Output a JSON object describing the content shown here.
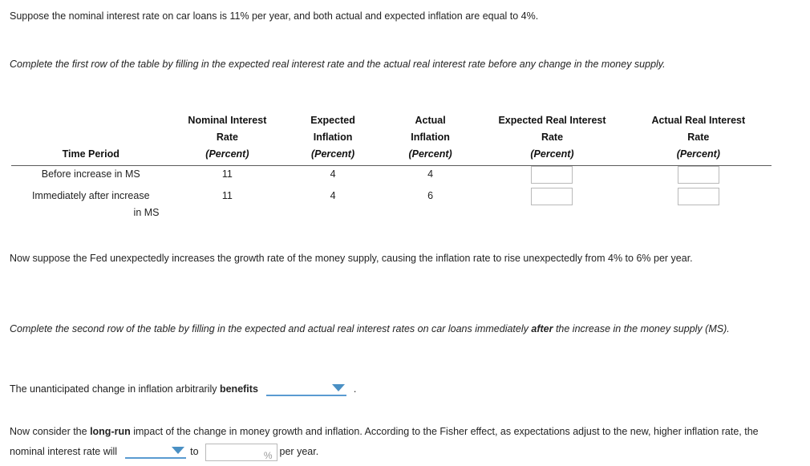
{
  "intro": {
    "line": "Suppose the nominal interest rate on car loans is 11% per year, and both actual and expected inflation are equal to 4%."
  },
  "instructions": {
    "first_row": "Complete the first row of the table by filling in the expected real interest rate and the actual real interest rate before any change in the money supply.",
    "second_row_pre": "Complete the second row of the table by filling in the expected and actual real interest rates on car loans immediately ",
    "second_row_bold": "after",
    "second_row_post": " the increase in the money supply (MS)."
  },
  "table": {
    "headers": {
      "time_period": "Time Period",
      "nominal": {
        "line1": "Nominal Interest",
        "line2": "Rate",
        "unit": "(Percent)"
      },
      "expected_inflation": {
        "line1": "Expected",
        "line2": "Inflation",
        "unit": "(Percent)"
      },
      "actual_inflation": {
        "line1": "Actual",
        "line2": "Inflation",
        "unit": "(Percent)"
      },
      "expected_real": {
        "line1": "Expected Real Interest",
        "line2": "Rate",
        "unit": "(Percent)"
      },
      "actual_real": {
        "line1": "Actual Real Interest",
        "line2": "Rate",
        "unit": "(Percent)"
      }
    },
    "rows": [
      {
        "period_line1": "Before increase in MS",
        "period_line2": "",
        "nominal": "11",
        "expected_inflation": "4",
        "actual_inflation": "4",
        "expected_real": "",
        "actual_real": ""
      },
      {
        "period_line1": "Immediately after increase",
        "period_line2": "in MS",
        "nominal": "11",
        "expected_inflation": "4",
        "actual_inflation": "6",
        "expected_real": "",
        "actual_real": ""
      }
    ]
  },
  "fed_paragraph": "Now suppose the Fed unexpectedly increases the growth rate of the money supply, causing the inflation rate to rise unexpectedly from 4% to 6% per year.",
  "benefits_sentence": {
    "pre": "The unanticipated change in inflation arbitrarily ",
    "bold": "benefits",
    "dropdown_value": "",
    "period": "."
  },
  "longrun_sentence": {
    "pre": "Now consider the ",
    "bold": "long-run",
    "mid": " impact of the change in money growth and inflation. According to the Fisher effect, as expectations adjust to the new, higher inflation rate, the nominal interest rate will",
    "dropdown_value": "",
    "to": "to",
    "input_value": "",
    "percent_sign": "%",
    "suffix": "per year."
  },
  "colors": {
    "accent_blue": "#4a90c4",
    "underline_blue": "#5a9bd1",
    "input_border": "#b9b9b9",
    "rule": "#5a5a5a"
  }
}
